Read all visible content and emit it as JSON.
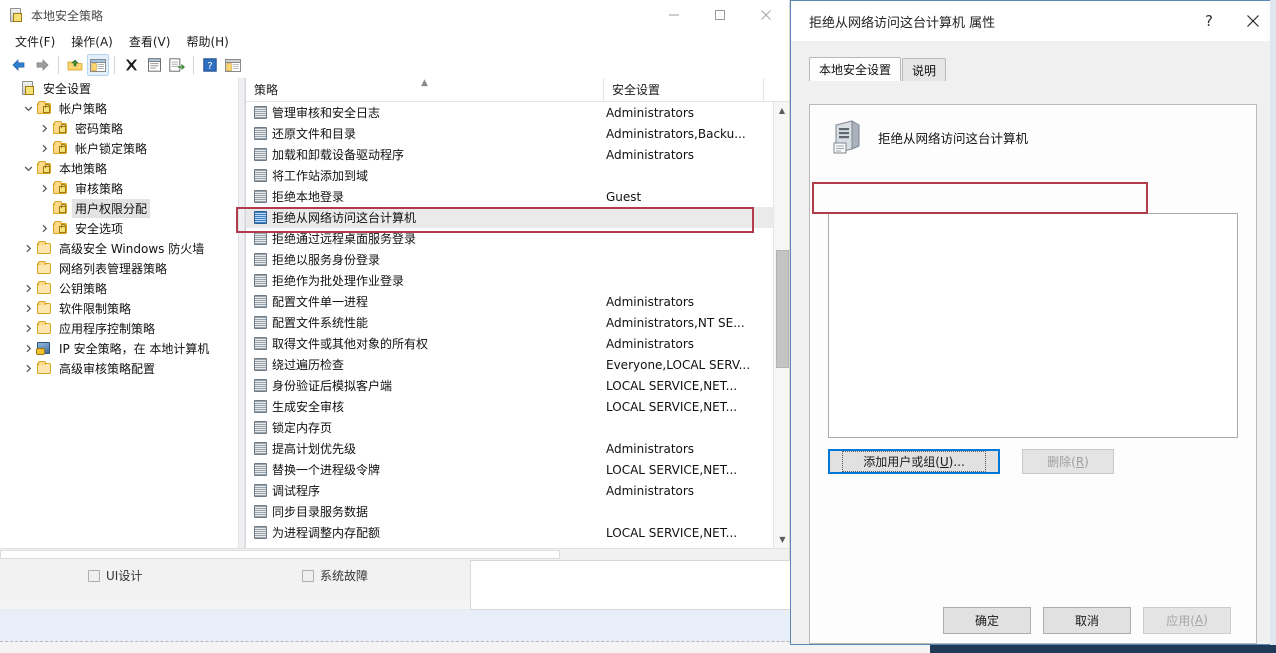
{
  "window": {
    "title": "本地安全策略",
    "icon": "security-policy-icon",
    "controls": {
      "minimize": "—",
      "maximize": "▭",
      "close": "✕"
    },
    "menus": [
      "文件(F)",
      "操作(A)",
      "查看(V)",
      "帮助(H)"
    ],
    "toolbar_icons": [
      "back-arrow-icon",
      "forward-arrow-icon",
      "up-folder-icon",
      "show-console-tree-icon",
      "delete-icon",
      "properties-icon",
      "export-list-icon",
      "help-icon",
      "new-window-icon"
    ]
  },
  "tree": {
    "items": [
      {
        "label": "安全设置",
        "depth": 0,
        "twisty": "",
        "icon": "security-settings-icon",
        "selected": false
      },
      {
        "label": "帐户策略",
        "depth": 1,
        "twisty": "v",
        "icon": "locked-folder-icon",
        "selected": false
      },
      {
        "label": "密码策略",
        "depth": 2,
        "twisty": ">",
        "icon": "locked-folder-icon",
        "selected": false
      },
      {
        "label": "帐户锁定策略",
        "depth": 2,
        "twisty": ">",
        "icon": "locked-folder-icon",
        "selected": false
      },
      {
        "label": "本地策略",
        "depth": 1,
        "twisty": "v",
        "icon": "locked-folder-icon",
        "selected": false
      },
      {
        "label": "审核策略",
        "depth": 2,
        "twisty": ">",
        "icon": "locked-folder-icon",
        "selected": false
      },
      {
        "label": "用户权限分配",
        "depth": 2,
        "twisty": "",
        "icon": "locked-folder-icon",
        "selected": true
      },
      {
        "label": "安全选项",
        "depth": 2,
        "twisty": ">",
        "icon": "locked-folder-icon",
        "selected": false
      },
      {
        "label": "高级安全 Windows 防火墙",
        "depth": 1,
        "twisty": ">",
        "icon": "folder-icon",
        "selected": false
      },
      {
        "label": "网络列表管理器策略",
        "depth": 1,
        "twisty": "",
        "icon": "folder-icon",
        "selected": false
      },
      {
        "label": "公钥策略",
        "depth": 1,
        "twisty": ">",
        "icon": "folder-icon",
        "selected": false
      },
      {
        "label": "软件限制策略",
        "depth": 1,
        "twisty": ">",
        "icon": "folder-icon",
        "selected": false
      },
      {
        "label": "应用程序控制策略",
        "depth": 1,
        "twisty": ">",
        "icon": "folder-icon",
        "selected": false
      },
      {
        "label": "IP 安全策略，在 本地计算机",
        "depth": 1,
        "twisty": ">",
        "icon": "ip-security-icon",
        "selected": false
      },
      {
        "label": "高级审核策略配置",
        "depth": 1,
        "twisty": ">",
        "icon": "folder-icon",
        "selected": false
      }
    ]
  },
  "list": {
    "columns": [
      {
        "label": "策略",
        "sorted": "asc"
      },
      {
        "label": "安全设置",
        "sorted": ""
      }
    ],
    "rows": [
      {
        "policy": "管理审核和安全日志",
        "setting": "Administrators",
        "selected": false
      },
      {
        "policy": "还原文件和目录",
        "setting": "Administrators,Backu...",
        "selected": false
      },
      {
        "policy": "加载和卸载设备驱动程序",
        "setting": "Administrators",
        "selected": false
      },
      {
        "policy": "将工作站添加到域",
        "setting": "",
        "selected": false
      },
      {
        "policy": "拒绝本地登录",
        "setting": "Guest",
        "selected": false
      },
      {
        "policy": "拒绝从网络访问这台计算机",
        "setting": "",
        "selected": true
      },
      {
        "policy": "拒绝通过远程桌面服务登录",
        "setting": "",
        "selected": false
      },
      {
        "policy": "拒绝以服务身份登录",
        "setting": "",
        "selected": false
      },
      {
        "policy": "拒绝作为批处理作业登录",
        "setting": "",
        "selected": false
      },
      {
        "policy": "配置文件单一进程",
        "setting": "Administrators",
        "selected": false
      },
      {
        "policy": "配置文件系统性能",
        "setting": "Administrators,NT SE...",
        "selected": false
      },
      {
        "policy": "取得文件或其他对象的所有权",
        "setting": "Administrators",
        "selected": false
      },
      {
        "policy": "绕过遍历检查",
        "setting": "Everyone,LOCAL SERV...",
        "selected": false
      },
      {
        "policy": "身份验证后模拟客户端",
        "setting": "LOCAL SERVICE,NET...",
        "selected": false
      },
      {
        "policy": "生成安全审核",
        "setting": "LOCAL SERVICE,NET...",
        "selected": false
      },
      {
        "policy": "锁定内存页",
        "setting": "",
        "selected": false
      },
      {
        "policy": "提高计划优先级",
        "setting": "Administrators",
        "selected": false
      },
      {
        "policy": "替换一个进程级令牌",
        "setting": "LOCAL SERVICE,NET...",
        "selected": false
      },
      {
        "policy": "调试程序",
        "setting": "Administrators",
        "selected": false
      },
      {
        "policy": "同步目录服务数据",
        "setting": "",
        "selected": false
      },
      {
        "policy": "为进程调整内存配额",
        "setting": "LOCAL SERVICE,NET...",
        "selected": false
      }
    ]
  },
  "dialog": {
    "title": "拒绝从网络访问这台计算机 属性",
    "help_glyph": "?",
    "close_glyph": "✕",
    "tabs": [
      {
        "label": "本地安全设置",
        "active": true
      },
      {
        "label": "说明",
        "active": false
      }
    ],
    "policy_name": "拒绝从网络访问这台计算机",
    "policy_icon": "server-computer-icon",
    "members": [],
    "add_button": "添加用户或组(U)...",
    "remove_button": "删除(R)",
    "footer": {
      "ok": "确定",
      "cancel": "取消",
      "apply": "应用(A)"
    }
  },
  "background_form": {
    "checkboxes": [
      {
        "label": "UI设计",
        "checked": false
      },
      {
        "label": "系统故障",
        "checked": false
      }
    ]
  },
  "annotations": {
    "color": "#b33a4a",
    "boxes": [
      {
        "name": "selected-policy-row-highlight"
      },
      {
        "name": "empty-member-list-highlight"
      }
    ]
  }
}
